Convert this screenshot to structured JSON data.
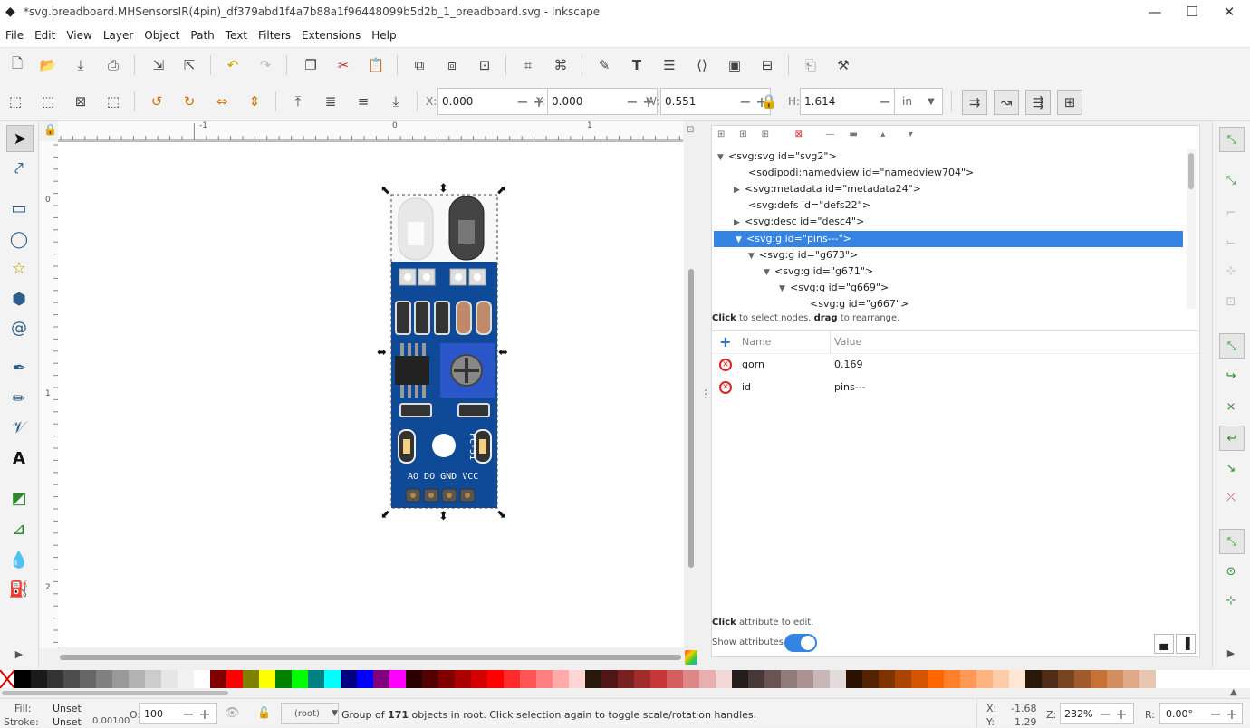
{
  "window": {
    "title": "*svg.breadboard.MHSensorsIR(4pin)_df379abd1f4a7b88a1f96448099b5d2b_1_breadboard.svg - Inkscape",
    "minimize": "—",
    "maximize": "☐",
    "close": "✕"
  },
  "menu": [
    "File",
    "Edit",
    "View",
    "Layer",
    "Object",
    "Path",
    "Text",
    "Filters",
    "Extensions",
    "Help"
  ],
  "controls": {
    "x_label": "X:",
    "x_value": "0.000",
    "y_label": "Y:",
    "y_value": "0.000",
    "w_label": "W:",
    "w_value": "0.551",
    "h_label": "H:",
    "h_value": "1.614",
    "unit": "in"
  },
  "rulers": {
    "top": [
      "-1",
      "0",
      "1"
    ],
    "left": [
      "0",
      "1",
      "2"
    ]
  },
  "board": {
    "label_fc": "FC-51",
    "pin_labels": "AO DO GND VCC"
  },
  "xml_editor": {
    "nodes": [
      {
        "text": "<svg:svg id=\"svg2\">",
        "tri": "▼"
      },
      {
        "text": "<sodipodi:namedview id=\"namedview704\">",
        "tri": ""
      },
      {
        "text": "<svg:metadata id=\"metadata24\">",
        "tri": "▶"
      },
      {
        "text": "<svg:defs id=\"defs22\">",
        "tri": ""
      },
      {
        "text": "<svg:desc id=\"desc4\">",
        "tri": "▶"
      },
      {
        "text": "<svg:g id=\"pins---\">",
        "tri": "▼"
      },
      {
        "text": "<svg:g id=\"g673\">",
        "tri": "▼"
      },
      {
        "text": "<svg:g id=\"g671\">",
        "tri": "▼"
      },
      {
        "text": "<svg:g id=\"g669\">",
        "tri": "▼"
      },
      {
        "text": "<svg:g id=\"g667\">",
        "tri": ""
      }
    ],
    "hint_bold1": "Click",
    "hint_text1": " to select nodes, ",
    "hint_bold2": "drag",
    "hint_text2": " to rearrange.",
    "attr_name_header": "Name",
    "attr_value_header": "Value",
    "attributes": [
      {
        "name": "gorn",
        "value": "0.169"
      },
      {
        "name": "id",
        "value": "pins---"
      }
    ],
    "edit_hint_bold": "Click",
    "edit_hint_text": " attribute to edit.",
    "show_attributes_label": "Show attributes"
  },
  "palette": [
    "#000000",
    "#1a1a1a",
    "#333333",
    "#4d4d4d",
    "#666666",
    "#808080",
    "#999999",
    "#b3b3b3",
    "#cccccc",
    "#e6e6e6",
    "#f2f2f2",
    "#ffffff",
    "#800000",
    "#ff0000",
    "#808000",
    "#ffff00",
    "#008000",
    "#00ff00",
    "#008080",
    "#00ffff",
    "#000080",
    "#0000ff",
    "#800080",
    "#ff00ff",
    "#2b0000",
    "#550000",
    "#800000",
    "#aa0000",
    "#d40000",
    "#ff0000",
    "#ff2a2a",
    "#ff5555",
    "#ff8080",
    "#ffaaaa",
    "#ffd5d5",
    "#28170b",
    "#501616",
    "#782121",
    "#a02c2c",
    "#c83737",
    "#d35f5f",
    "#de8787",
    "#e9afaf",
    "#f4d7d7",
    "#241c1c",
    "#483737",
    "#6c5353",
    "#917c7c",
    "#ac9393",
    "#c8b7b7",
    "#e3dbdb",
    "#2b1100",
    "#552200",
    "#803300",
    "#aa4400",
    "#d45500",
    "#ff6600",
    "#ff7f2a",
    "#ff9955",
    "#ffb380",
    "#ffccaa",
    "#ffe6d5",
    "#28170b",
    "#502d16",
    "#784421",
    "#a05a2c",
    "#c87137",
    "#d38d5f",
    "#deaa87",
    "#e9c6af"
  ],
  "status": {
    "fill_label": "Fill:",
    "fill_value": "Unset",
    "stroke_label": "Stroke:",
    "stroke_value": "Unset",
    "stroke_width": "0.00100",
    "opacity_label": "O:",
    "opacity_value": "100",
    "layer": "(root)",
    "message_pre": "Group of ",
    "message_count": "171",
    "message_post": " objects in root. Click selection again to toggle scale/rotation handles.",
    "x_label": "X:",
    "x_value": "-1.68",
    "y_label": "Y:",
    "y_value": "1.29",
    "zoom_label": "Z:",
    "zoom_value": "232%",
    "rotate_label": "R:",
    "rotate_value": "0.00°"
  }
}
